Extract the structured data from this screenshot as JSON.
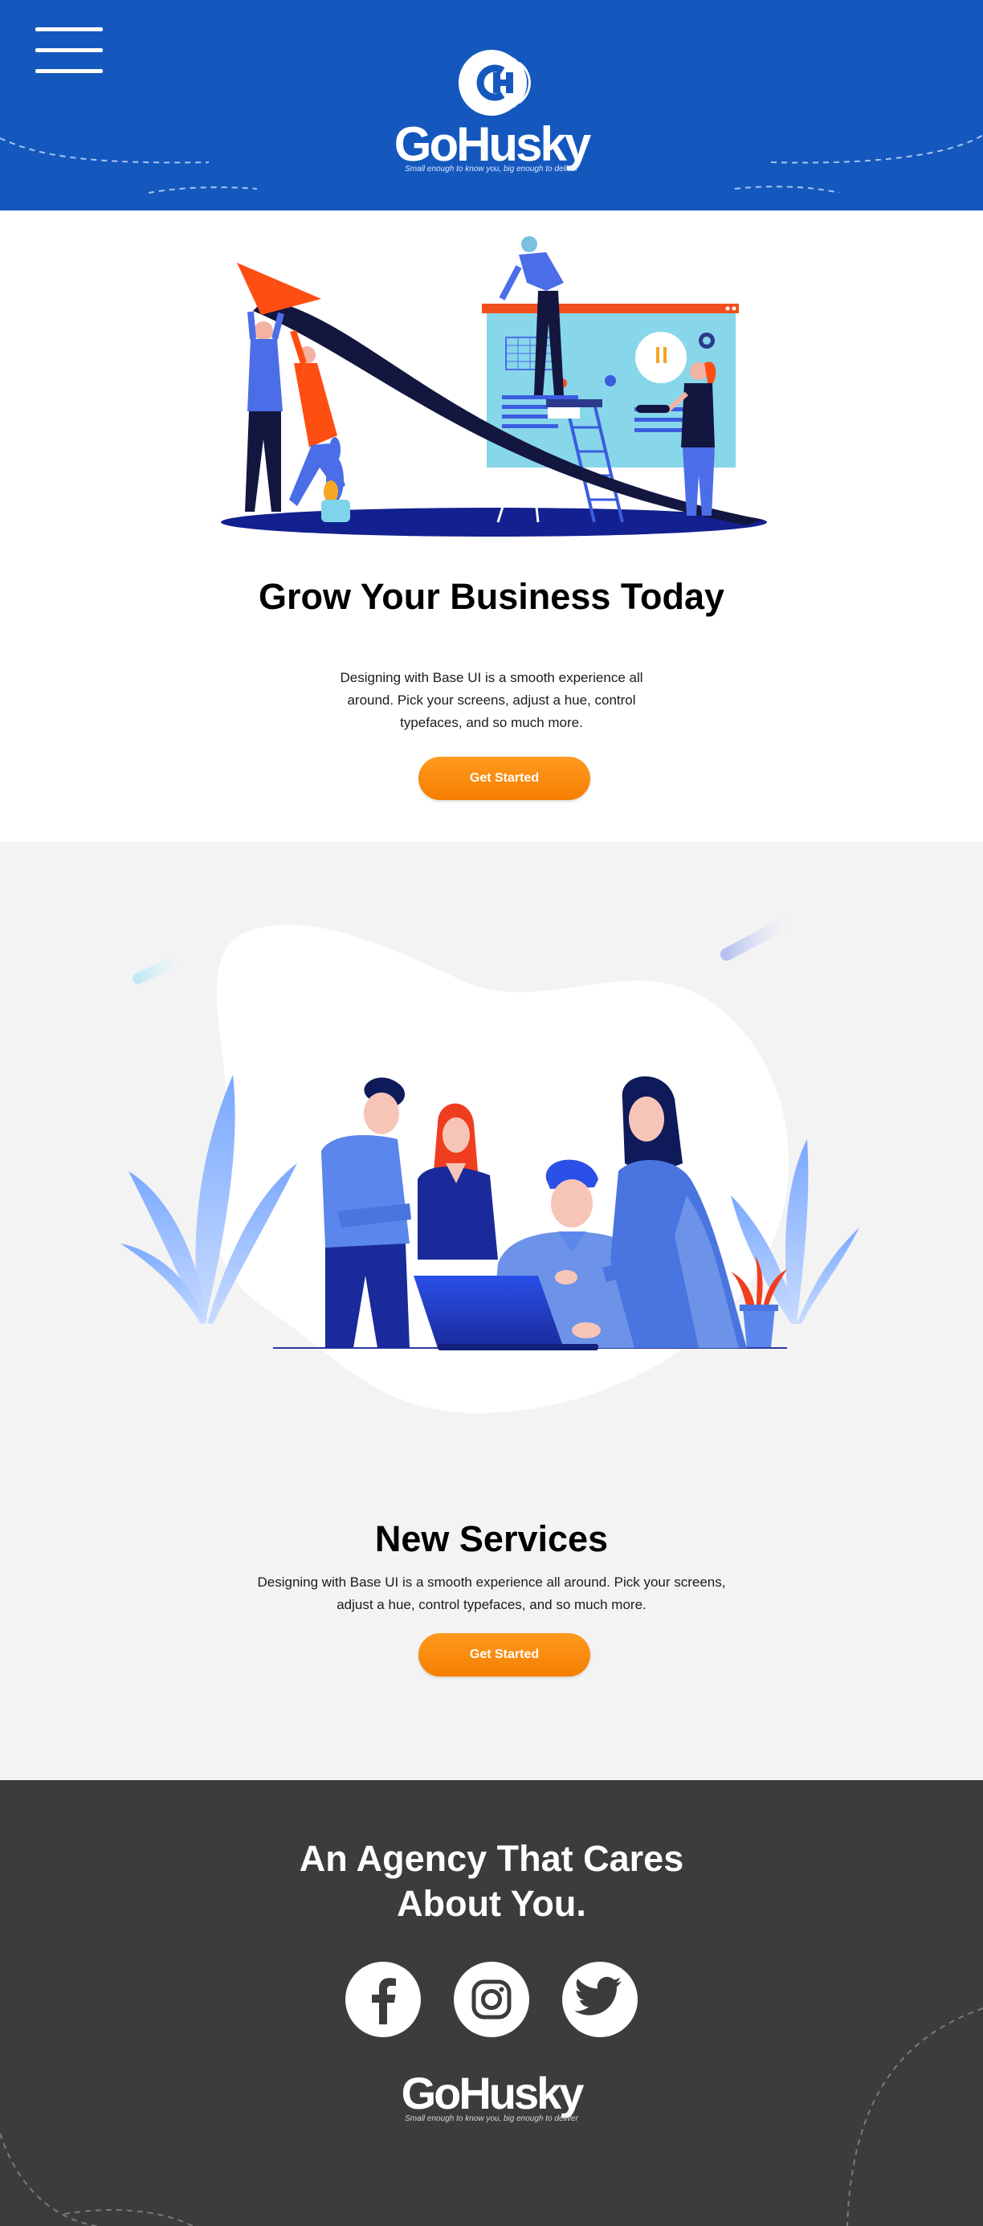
{
  "header": {
    "menu_icon": "hamburger-icon",
    "logo_icon": "gohusky-logo-mark",
    "brand_name": "GoHusky",
    "tagline": "Small enough to know you, big enough to deliver"
  },
  "hero": {
    "title": "Grow Your Business Today",
    "text": "Designing with Base UI is a smooth experience all around. Pick your screens, adjust a hue, control typefaces, and so much more.",
    "button_label": "Get Started"
  },
  "services": {
    "title": "New Services",
    "text": "Designing with Base UI is a smooth experience all around. Pick your screens, adjust a hue, control typefaces, and so much more.",
    "button_label": "Get Started"
  },
  "footer": {
    "title": "An Agency That Cares About You.",
    "social": [
      {
        "icon": "facebook-icon"
      },
      {
        "icon": "instagram-icon"
      },
      {
        "icon": "twitter-icon"
      }
    ],
    "brand_name": "GoHusky",
    "tagline": "Small enough to know you, big enough to deliver"
  },
  "colors": {
    "header_bg": "#1458be",
    "button": "#f98a0b",
    "footer_bg": "#3c3c3c",
    "section_bg": "#f3f3f3"
  }
}
